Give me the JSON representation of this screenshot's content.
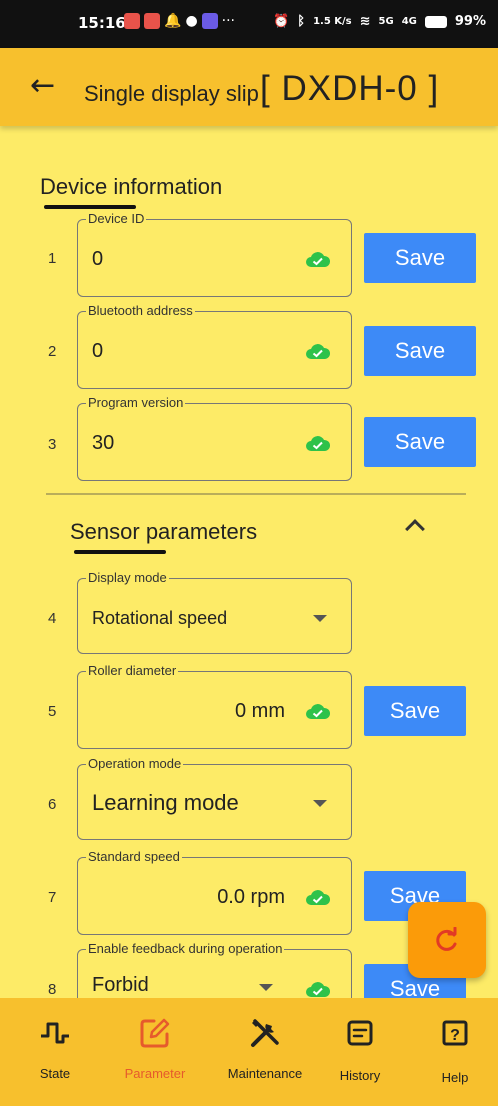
{
  "status_bar": {
    "time": "15:16",
    "net_speed": "1.5 K/s",
    "signal": "5G",
    "signal2": "4G",
    "battery": "99%"
  },
  "app_bar": {
    "title": "Single display slip",
    "model": "[ DXDH-0 ]"
  },
  "device_info": {
    "title": "Device information",
    "rows": [
      {
        "num": "1",
        "label": "Device ID",
        "value": "0",
        "save": "Save"
      },
      {
        "num": "2",
        "label": "Bluetooth address",
        "value": "0",
        "save": "Save"
      },
      {
        "num": "3",
        "label": "Program version",
        "value": "30",
        "save": "Save"
      }
    ]
  },
  "sensor_params": {
    "title": "Sensor parameters",
    "rows": [
      {
        "num": "4",
        "label": "Display mode",
        "value": "Rotational speed"
      },
      {
        "num": "5",
        "label": "Roller diameter",
        "value": "0 mm",
        "save": "Save"
      },
      {
        "num": "6",
        "label": "Operation mode",
        "value": "Learning mode"
      },
      {
        "num": "7",
        "label": "Standard speed",
        "value": "0.0 rpm",
        "save": "Save"
      },
      {
        "num": "8",
        "label": "Enable feedback during operation",
        "value": "Forbid",
        "save": "Save"
      }
    ]
  },
  "bottom_nav": [
    {
      "label": "State",
      "icon": "pulse-icon"
    },
    {
      "label": "Parameter",
      "icon": "edit-icon",
      "active": true
    },
    {
      "label": "Maintenance",
      "icon": "tools-icon"
    },
    {
      "label": "History",
      "icon": "history-icon"
    },
    {
      "label": "Help",
      "icon": "help-icon"
    }
  ],
  "colors": {
    "background": "#fdeb67",
    "app_bar": "#f7c02d",
    "save_button": "#3d8af7",
    "fab": "#fb9b09",
    "active_nav": "#e65a2c",
    "cloud_ok": "#2ec24a"
  }
}
